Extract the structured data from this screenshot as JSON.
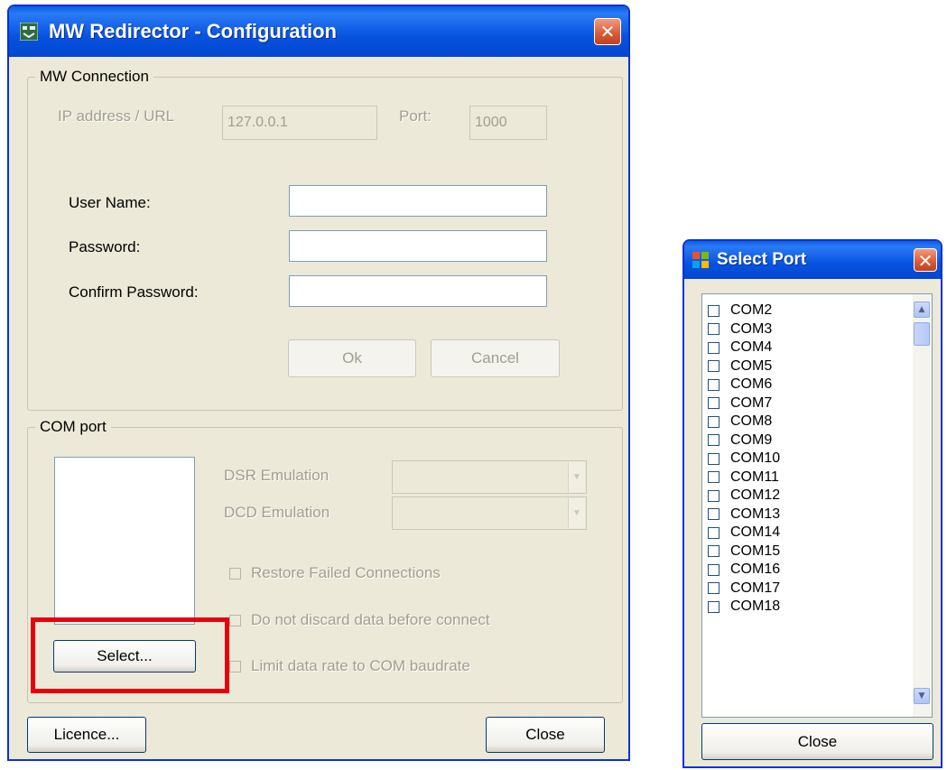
{
  "main_window": {
    "title": "MW Redirector - Configuration",
    "close_glyph": "✕",
    "mw_connection": {
      "group_label": "MW Connection",
      "ip_label": "IP address / URL",
      "ip_value": "127.0.0.1",
      "port_label": "Port:",
      "port_value": "1000",
      "user_name_label": "User Name:",
      "user_name_value": "",
      "password_label": "Password:",
      "password_value": "",
      "confirm_password_label": "Confirm Password:",
      "confirm_password_value": "",
      "ok_label": "Ok",
      "cancel_label": "Cancel"
    },
    "com_port": {
      "group_label": "COM port",
      "dsr_label": "DSR Emulation",
      "dcd_label": "DCD Emulation",
      "restore_label": "Restore Failed Connections",
      "no_discard_label": "Do not discard data before connect",
      "limit_rate_label": "Limit data rate to COM baudrate",
      "select_label": "Select..."
    },
    "licence_label": "Licence...",
    "close_label": "Close"
  },
  "select_port": {
    "title": "Select Port",
    "close_glyph": "✕",
    "ports": [
      "COM2",
      "COM3",
      "COM4",
      "COM5",
      "COM6",
      "COM7",
      "COM8",
      "COM9",
      "COM10",
      "COM11",
      "COM12",
      "COM13",
      "COM14",
      "COM15",
      "COM16",
      "COM17",
      "COM18"
    ],
    "close_label": "Close"
  },
  "colors": {
    "title_bar": "#0654e3",
    "dialog_bg": "#ece9d8",
    "highlight": "#e8000b",
    "disabled_text": "#a19e8f"
  },
  "icons": {
    "main_app": "redirector-app-icon",
    "select_port_app": "windows-app-icon",
    "scroll_up": "scroll-up-arrow-icon",
    "scroll_down": "scroll-down-arrow-icon",
    "combo": "chevron-down-icon"
  }
}
